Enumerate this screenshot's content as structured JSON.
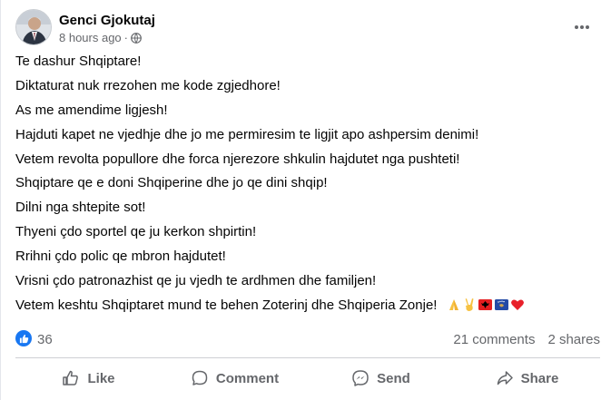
{
  "post": {
    "author": "Genci Gjokutaj",
    "time": "8 hours ago",
    "separator": "·",
    "privacy_icon": "globe-icon",
    "lines": [
      "Te dashur Shqiptare!",
      "Diktaturat  nuk rrezohen me kode zgjedhore!",
      "As me amendime ligjesh!",
      "Hajduti kapet ne vjedhje dhe jo me permiresim te ligjit apo ashpersim denimi!",
      "Vetem revolta popullore dhe forca njerezore shkulin hajdutet nga pushteti!",
      "Shqiptare qe e doni Shqiperine dhe jo qe dini shqip!",
      "Dilni nga shtepite sot!",
      "Thyeni çdo sportel qe ju kerkon shpirtin!",
      "Rrihni çdo polic qe mbron hajdutet!",
      "Vrisni çdo patronazhist qe ju vjedh te ardhmen dhe familjen!",
      "Vetem keshtu Shqiptaret mund te behen Zoterinj dhe Shqiperia Zonje!"
    ],
    "emojis": [
      "folded-hands",
      "victory-hand",
      "albania-flag",
      "kosovo-flag",
      "red-heart"
    ]
  },
  "stats": {
    "likes": "36",
    "comments": "21 comments",
    "shares": "2 shares"
  },
  "actions": {
    "like": "Like",
    "comment": "Comment",
    "send": "Send",
    "share": "Share"
  },
  "colors": {
    "brand_blue": "#1877f2",
    "secondary_text": "#65676b",
    "primary_text": "#050505",
    "divider": "#ced0d4"
  }
}
